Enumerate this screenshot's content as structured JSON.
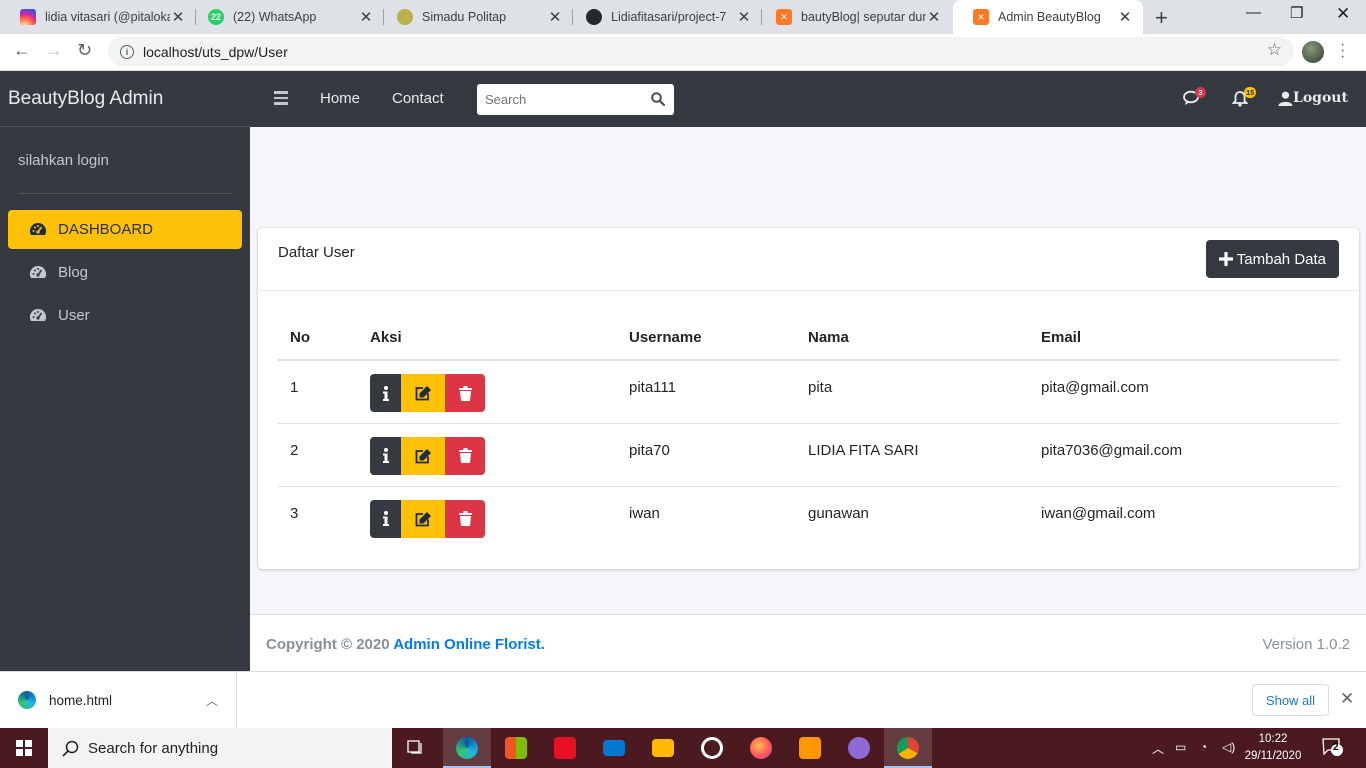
{
  "browser": {
    "tabs": [
      {
        "title": "lidia vitasari (@pitaloka",
        "favicon": "instagram-icon",
        "color": "#d62976"
      },
      {
        "title": "(22) WhatsApp",
        "favicon": "whatsapp-icon",
        "badge": "22",
        "color": "#25d366"
      },
      {
        "title": "Simadu Politap",
        "favicon": "politap-logo-icon",
        "color": "#8a8a2a"
      },
      {
        "title": "Lidiafitasari/project-7",
        "favicon": "github-icon",
        "color": "#24292e"
      },
      {
        "title": "bautyBlog| seputar duni",
        "favicon": "xampp-icon",
        "color": "#fb7a24"
      },
      {
        "title": "Admin BeautyBlog",
        "favicon": "xampp-icon",
        "color": "#fb7a24"
      }
    ],
    "url": "localhost/uts_dpw/User"
  },
  "sidebar": {
    "brand": "BeautyBlog Admin",
    "user_text": "silahkan login",
    "items": [
      {
        "label": "DASHBOARD",
        "active": true
      },
      {
        "label": "Blog",
        "active": false
      },
      {
        "label": "User",
        "active": false
      }
    ]
  },
  "navbar": {
    "links": [
      "Home",
      "Contact"
    ],
    "search_placeholder": "Search",
    "messages_count": "3",
    "notifications_count": "15",
    "logout_label": "Logout"
  },
  "card": {
    "title": "Daftar User",
    "add_button": "Tambah Data",
    "columns": [
      "No",
      "Aksi",
      "Username",
      "Nama",
      "Email"
    ],
    "rows": [
      {
        "no": "1",
        "username": "pita111",
        "nama": "pita",
        "email": "pita@gmail.com"
      },
      {
        "no": "2",
        "username": "pita70",
        "nama": "LIDIA FITA SARI",
        "email": "pita7036@gmail.com"
      },
      {
        "no": "3",
        "username": "iwan",
        "nama": "gunawan",
        "email": "iwan@gmail.com"
      }
    ]
  },
  "footer": {
    "copyright_prefix": "Copyright © 2020 ",
    "copyright_link": "Admin Online Florist.",
    "version": "Version 1.0.2"
  },
  "downloads": {
    "file": "home.html",
    "show_all": "Show all"
  },
  "taskbar": {
    "search_placeholder": "Search for anything",
    "time": "10:22",
    "date": "29/11/2020",
    "notification_count": "2"
  },
  "colors": {
    "sidebar_bg": "#343a40",
    "active_menu": "#ffc107",
    "danger": "#dc3545",
    "link": "#007bff"
  }
}
